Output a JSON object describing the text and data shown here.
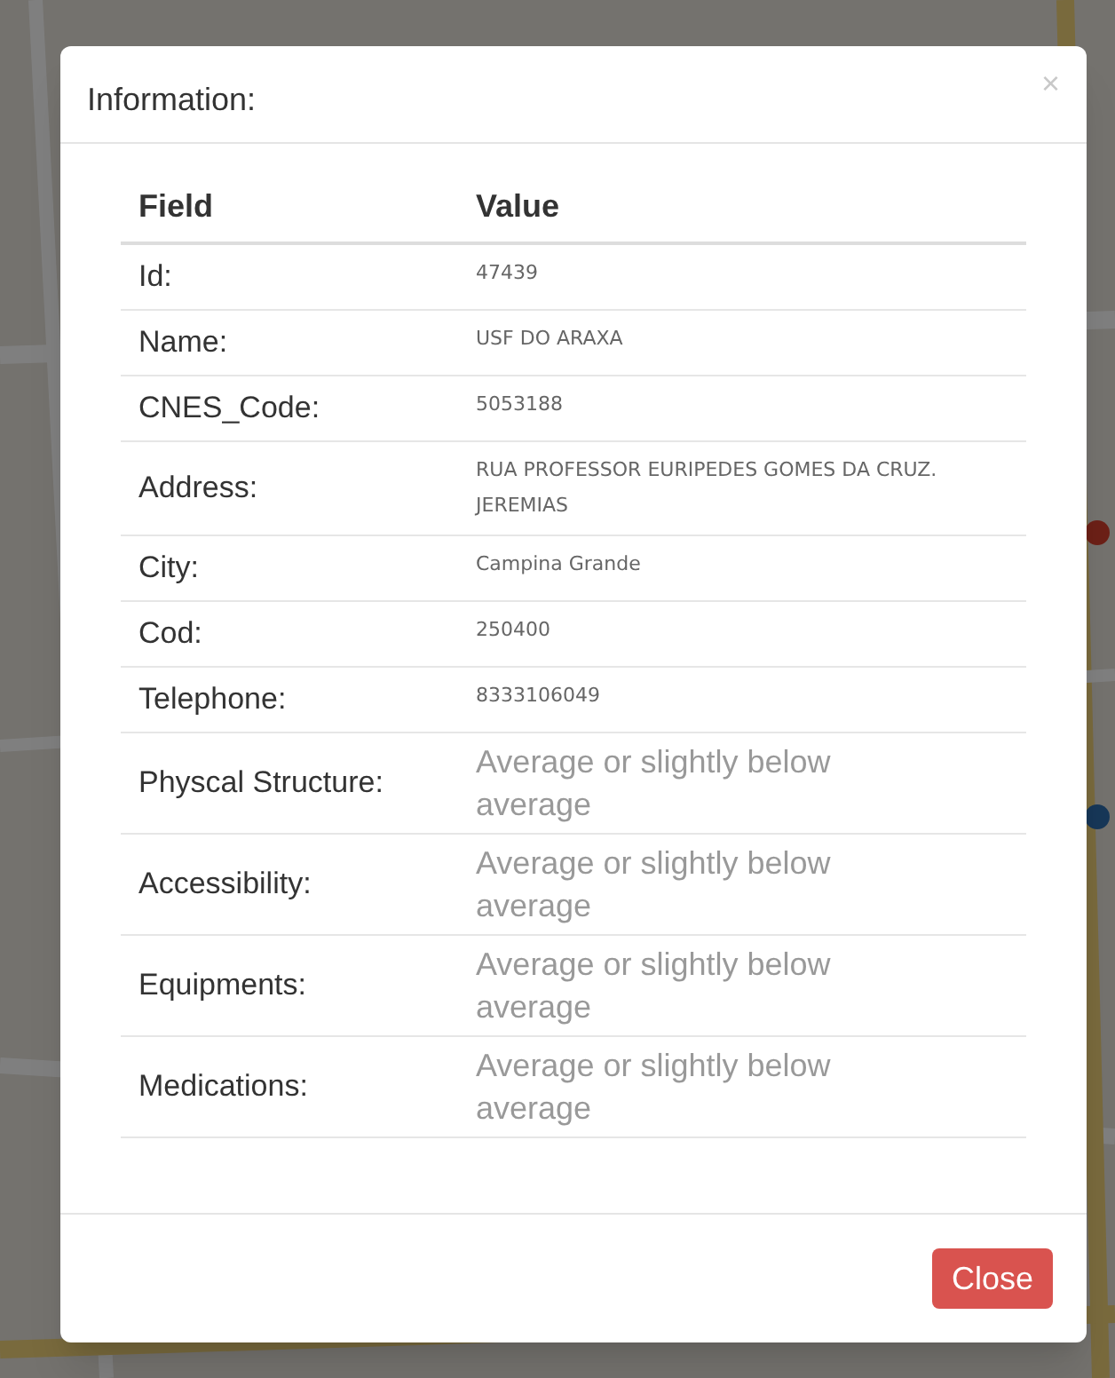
{
  "dialog": {
    "title": "Information:",
    "close_icon": "×",
    "table": {
      "columns": [
        "Field",
        "Value"
      ],
      "rows": [
        {
          "field": "Id:",
          "value": "47439",
          "kind": "code"
        },
        {
          "field": "Name:",
          "value": "USF DO ARAXA",
          "kind": "code"
        },
        {
          "field": "CNES_Code:",
          "value": "5053188",
          "kind": "code"
        },
        {
          "field": "Address:",
          "value": "RUA PROFESSOR EURIPEDES GOMES DA CRUZ. JEREMIAS",
          "kind": "code"
        },
        {
          "field": "City:",
          "value": "Campina Grande",
          "kind": "code"
        },
        {
          "field": "Cod:",
          "value": "250400",
          "kind": "code"
        },
        {
          "field": "Telephone:",
          "value": "8333106049",
          "kind": "code"
        },
        {
          "field": "Physcal Structure:",
          "value": "Average or slightly below average",
          "kind": "rating"
        },
        {
          "field": "Accessibility:",
          "value": "Average or slightly below average",
          "kind": "rating"
        },
        {
          "field": "Equipments:",
          "value": "Average or slightly below average",
          "kind": "rating"
        },
        {
          "field": "Medications:",
          "value": "Average or slightly below average",
          "kind": "rating"
        }
      ]
    },
    "buttons": [
      {
        "label": "Close",
        "kind": "danger"
      }
    ]
  }
}
